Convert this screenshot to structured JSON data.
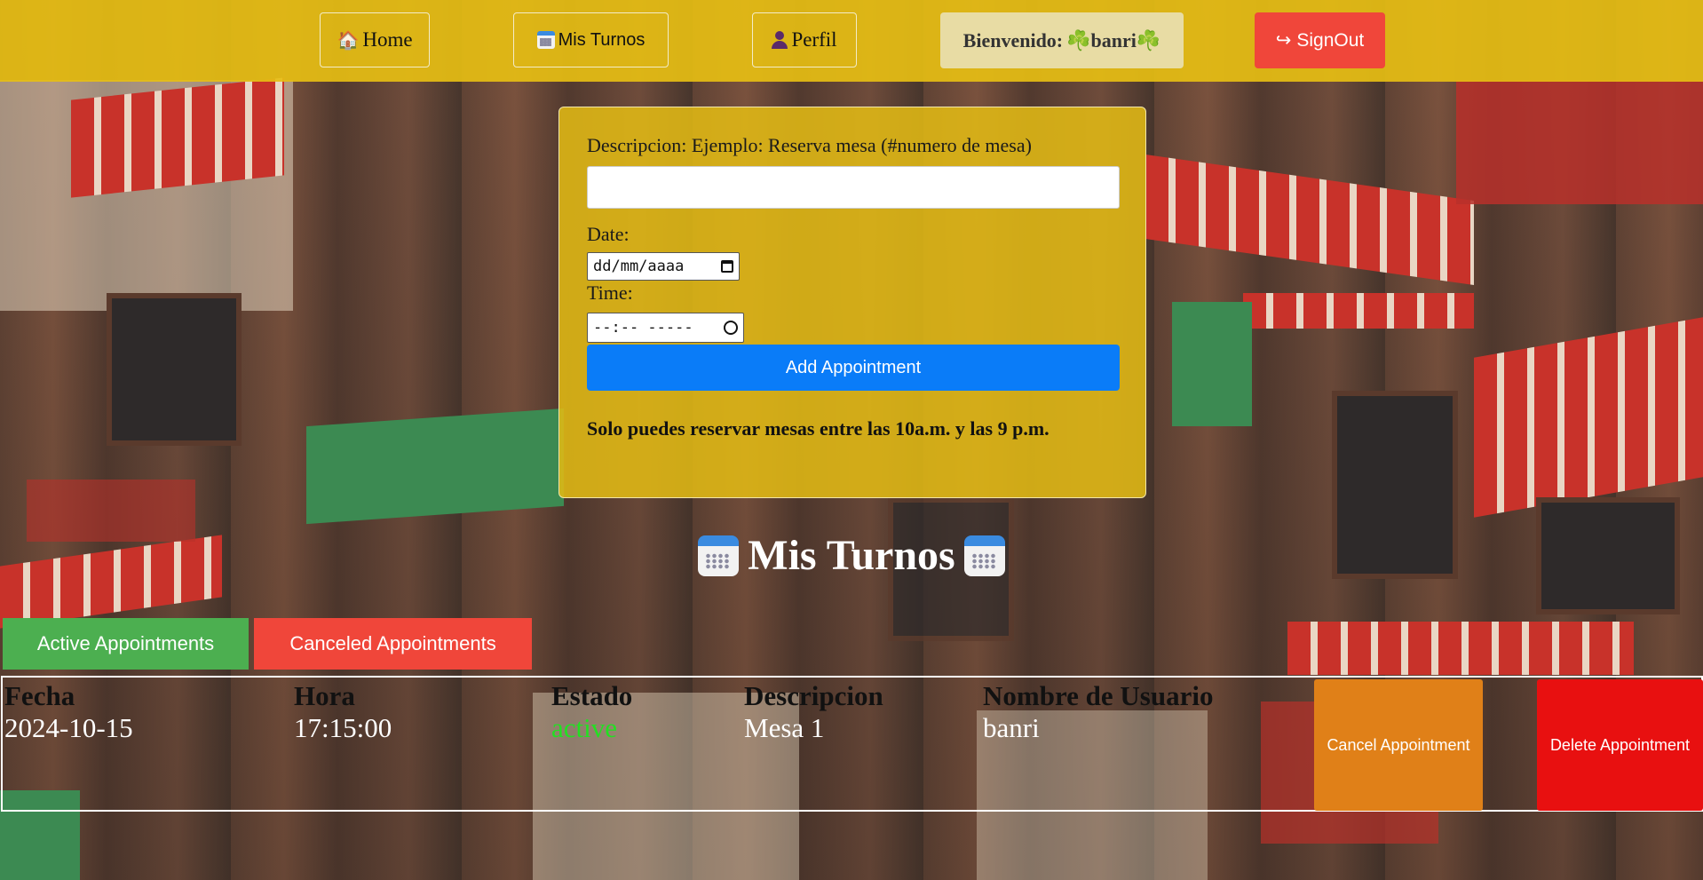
{
  "nav": {
    "home_label": "Home",
    "home_icon": "house-icon",
    "turnos_label": "Mis Turnos",
    "turnos_icon": "calendar-icon",
    "perfil_label": "Perfil",
    "perfil_icon": "person-icon",
    "welcome_label": "Bienvenido:",
    "username": "banri",
    "clover_glyph": "☘️",
    "signout_label": "SignOut",
    "signout_icon": "↪"
  },
  "form": {
    "description_label": "Descripcion: Ejemplo: Reserva mesa (#numero de mesa)",
    "description_value": "",
    "date_label": "Date:",
    "date_placeholder": "dd/mm/aaaa",
    "time_label": "Time:",
    "time_placeholder": "--:-- -----",
    "submit_label": "Add Appointment",
    "note": "Solo puedes reservar mesas entre las 10a.m. y las 9 p.m."
  },
  "section": {
    "title": "Mis Turnos",
    "active_tab": "Active Appointments",
    "canceled_tab": "Canceled Appointments"
  },
  "table": {
    "headers": [
      "Fecha",
      "Hora",
      "Estado",
      "Descripcion",
      "Nombre de Usuario"
    ],
    "rows": [
      {
        "fecha": "2024-10-15",
        "hora": "17:15:00",
        "estado": "active",
        "descripcion": "Mesa 1",
        "usuario": "banri",
        "cancel_label": "Cancel Appointment",
        "delete_label": "Delete Appointment"
      }
    ]
  },
  "colors": {
    "nav_bg": "#e6be14",
    "signout": "#f0463a",
    "submit": "#0a7cf8",
    "active_tab": "#4caf50",
    "canceled_tab": "#f0463a",
    "cancel_btn": "#e08018",
    "delete_btn": "#e81010",
    "status_active": "#22e022"
  }
}
